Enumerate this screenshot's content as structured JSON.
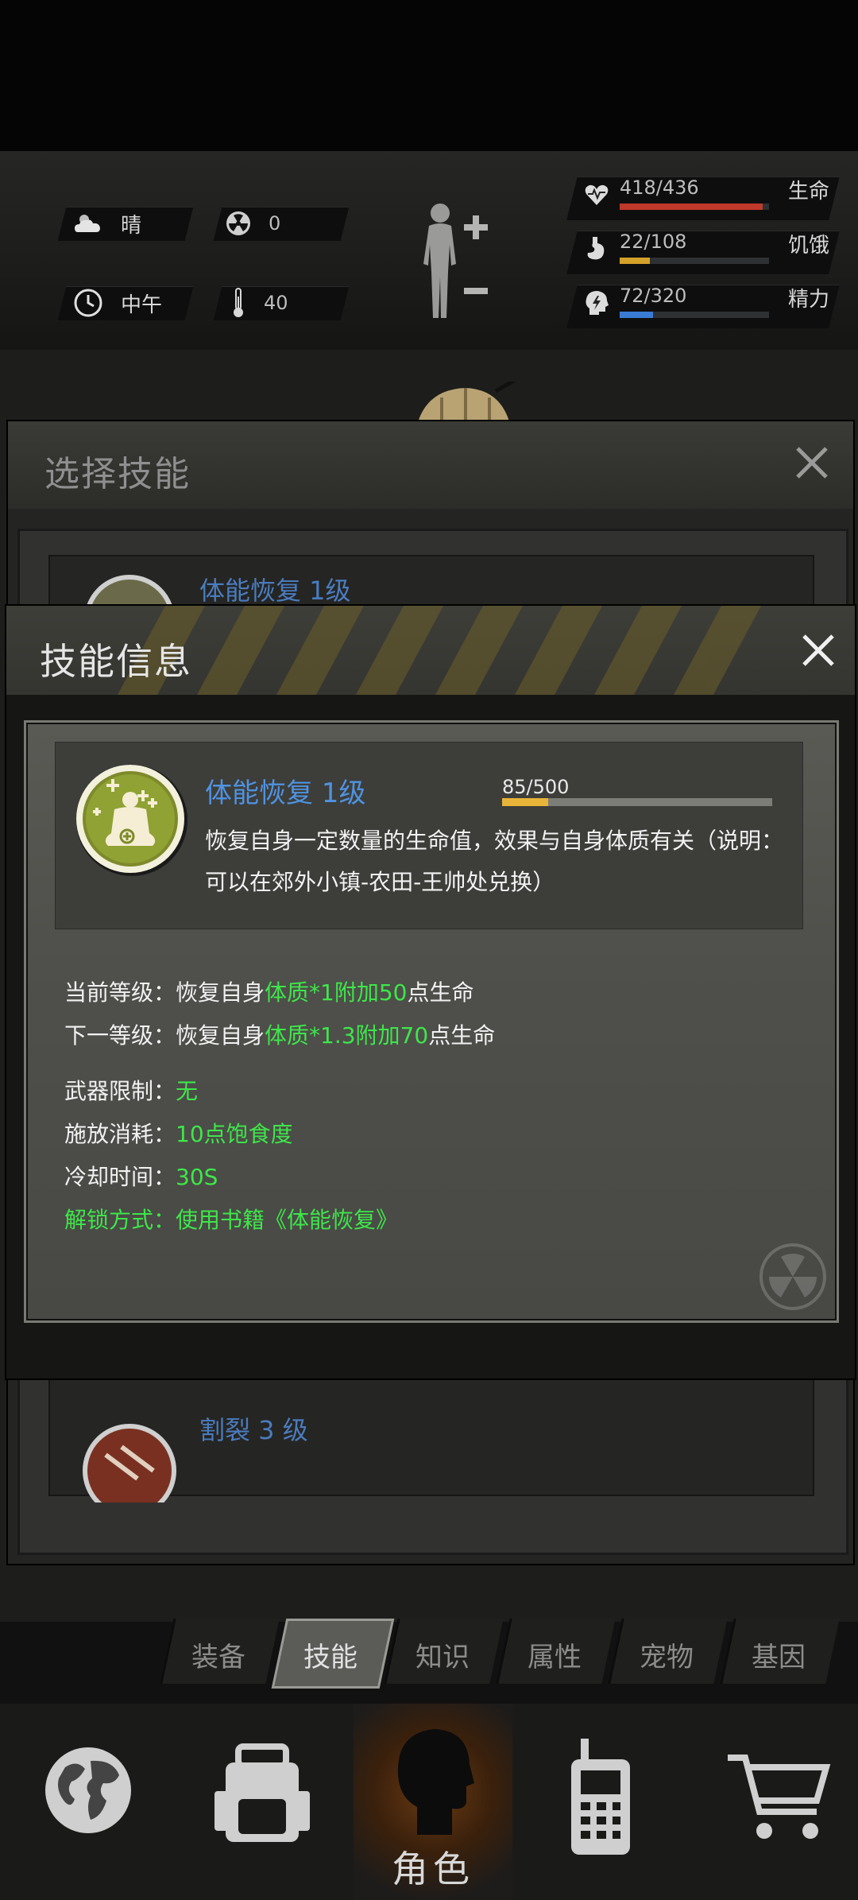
{
  "hud": {
    "weather": "晴",
    "radiation": "0",
    "time_of_day": "中午",
    "temperature": "40",
    "stats": [
      {
        "label": "生命",
        "value": "418/436",
        "fraction": 0.9587,
        "color": "#c0392b",
        "icon": "heart-pulse-icon"
      },
      {
        "label": "饥饿",
        "value": "22/108",
        "fraction": 0.2037,
        "color": "#d4a12a",
        "icon": "stomach-icon"
      },
      {
        "label": "精力",
        "value": "72/320",
        "fraction": 0.225,
        "color": "#3a7bd5",
        "icon": "energy-head-icon"
      }
    ]
  },
  "select_panel": {
    "title": "选择技能",
    "items": [
      {
        "label": "体能恢复 1级"
      },
      {
        "label": "割裂 3 级"
      }
    ]
  },
  "popup": {
    "title": "技能信息",
    "skill_name": "体能恢复 1级",
    "xp_text": "85/500",
    "xp_fraction": 0.17,
    "description": "恢复自身一定数量的生命值，效果与自身体质有关（说明：可以在郊外小镇-农田-王帅处兑换）",
    "current_level": {
      "label": "当前等级：",
      "prefix": "恢复自身",
      "highlight": "体质*1附加50",
      "suffix": "点生命"
    },
    "next_level": {
      "label": "下一等级：",
      "prefix": "恢复自身",
      "highlight": "体质*1.3附加70",
      "suffix": "点生命"
    },
    "weapon_limit": {
      "label": "武器限制：",
      "value": "无"
    },
    "cast_cost": {
      "label": "施放消耗：",
      "value": "10点饱食度"
    },
    "cooldown": {
      "label": "冷却时间：",
      "value": "30S"
    },
    "unlock": {
      "label": "解锁方式：",
      "value": "使用书籍《体能恢复》"
    }
  },
  "tabs": [
    {
      "label": "装备",
      "active": false
    },
    {
      "label": "技能",
      "active": true
    },
    {
      "label": "知识",
      "active": false
    },
    {
      "label": "属性",
      "active": false
    },
    {
      "label": "宠物",
      "active": false
    },
    {
      "label": "基因",
      "active": false
    }
  ],
  "nav": {
    "role_label": "角色",
    "items": [
      "globe-icon",
      "backpack-icon",
      "role-head-icon",
      "walkie-talkie-icon",
      "shopping-cart-icon"
    ]
  }
}
